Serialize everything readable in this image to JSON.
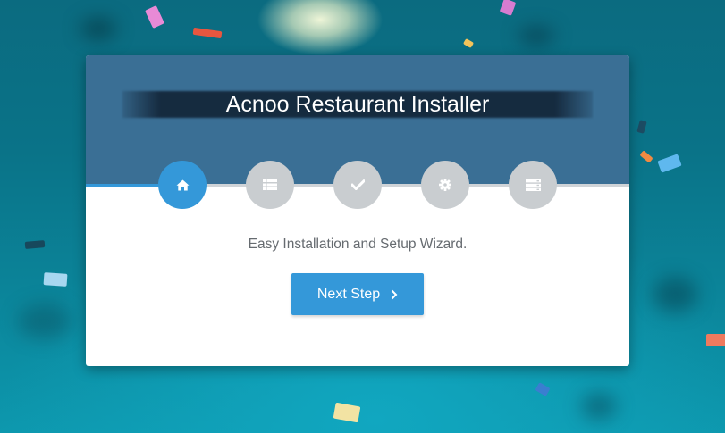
{
  "installer": {
    "title": "Acnoo Restaurant Installer",
    "subtitle": "Easy Installation and Setup Wizard.",
    "next_label": "Next Step",
    "progress": 0.15,
    "active_step": 1,
    "steps": [
      {
        "icon": "home-icon",
        "state": "active"
      },
      {
        "icon": "list-icon",
        "state": "inactive"
      },
      {
        "icon": "checkmark-icon",
        "state": "inactive"
      },
      {
        "icon": "gear-icon",
        "state": "inactive"
      },
      {
        "icon": "server-icon",
        "state": "inactive"
      }
    ]
  },
  "colors": {
    "accent": "#3498d9",
    "header": "#3a6f95",
    "step_inactive": "#c9cdd0",
    "background": "#0b7a8e"
  }
}
